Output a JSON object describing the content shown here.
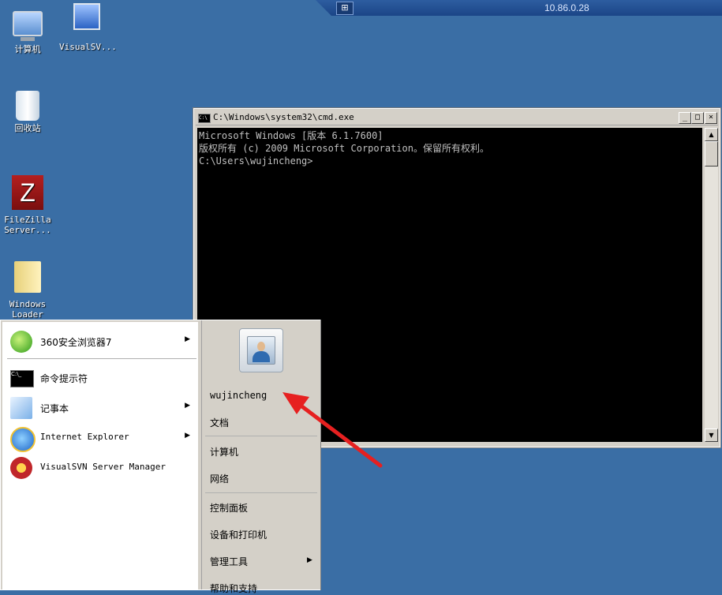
{
  "rdp_bar": {
    "ip": "10.86.0.28",
    "pin_glyph": "⊞"
  },
  "desktop_icons": [
    {
      "label": "计算机"
    },
    {
      "label": "VisualSV..."
    },
    {
      "label": "回收站"
    },
    {
      "label1": "FileZilla",
      "label2": "Server..."
    },
    {
      "label1": "Windows",
      "label2": "Loader"
    }
  ],
  "cmd": {
    "title": "C:\\Windows\\system32\\cmd.exe",
    "lines": [
      "Microsoft Windows [版本 6.1.7600]",
      "版权所有 (c) 2009 Microsoft Corporation。保留所有权利。",
      "",
      "C:\\Users\\wujincheng>"
    ],
    "min_glyph": "_",
    "max_glyph": "□",
    "close_glyph": "×",
    "scroll_up": "▲",
    "scroll_down": "▼"
  },
  "start_menu": {
    "programs": [
      {
        "label": "360安全浏览器7",
        "has_submenu": true
      },
      {
        "label": "命令提示符",
        "has_submenu": false
      },
      {
        "label": "记事本",
        "has_submenu": true
      },
      {
        "label": "Internet Explorer",
        "has_submenu": true
      },
      {
        "label": "VisualSVN Server Manager",
        "has_submenu": false
      }
    ],
    "arrow_glyph": "▶",
    "right": {
      "username": "wujincheng",
      "items": [
        "文档",
        "计算机",
        "网络",
        "控制面板",
        "设备和打印机",
        "管理工具",
        "帮助和支持"
      ]
    }
  },
  "colors": {
    "desktop": "#3a6ea5",
    "annotation": "#e62020"
  }
}
